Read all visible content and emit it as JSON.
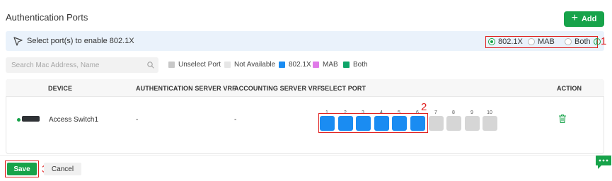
{
  "section": {
    "title": "Authentication Ports"
  },
  "toolbar": {
    "add_label": "Add",
    "add_icon": "plus-icon"
  },
  "info_bar": {
    "icon": "cursor-pointer-icon",
    "text": "Select port(s) to enable 802.1X",
    "modes": [
      {
        "label": "802.1X",
        "checked": true
      },
      {
        "label": "MAB",
        "checked": false
      },
      {
        "label": "Both",
        "checked": false
      }
    ],
    "info_icon_glyph": "i"
  },
  "annotations": {
    "one": "1",
    "two": "2",
    "three": "3"
  },
  "search": {
    "placeholder": "Search Mac Address, Name",
    "value": ""
  },
  "legend": [
    {
      "label": "Unselect Port",
      "color": "#c8c8c8"
    },
    {
      "label": "Not Available",
      "color": "#e6e6e6"
    },
    {
      "label": "802.1X",
      "color": "#1a8cf2"
    },
    {
      "label": "MAB",
      "color": "#e07ae8"
    },
    {
      "label": "Both",
      "color": "#0ea569"
    }
  ],
  "table": {
    "headers": [
      "DEVICE",
      "AUTHENTICATION SERVER VRF",
      "ACCOUNTING SERVER VRF",
      "SELECT PORT",
      "ACTION"
    ],
    "row": {
      "status": "online",
      "device": "Access Switch1",
      "auth_vrf": "-",
      "acct_vrf": "-",
      "ports": [
        {
          "num": "1",
          "selected": true
        },
        {
          "num": "2",
          "selected": true
        },
        {
          "num": "3",
          "selected": true
        },
        {
          "num": "4",
          "selected": true
        },
        {
          "num": "5",
          "selected": true
        },
        {
          "num": "6",
          "selected": true
        },
        {
          "num": "7",
          "selected": false
        },
        {
          "num": "8",
          "selected": false
        },
        {
          "num": "9",
          "selected": false
        },
        {
          "num": "10",
          "selected": false
        }
      ],
      "action_icon": "trash-icon"
    }
  },
  "footer": {
    "save_label": "Save",
    "cancel_label": "Cancel"
  },
  "colors": {
    "accent": "#17a34a",
    "port_selected": "#1a8cf2",
    "port_unselected": "#d6d6d6",
    "highlight": "#e02020"
  }
}
